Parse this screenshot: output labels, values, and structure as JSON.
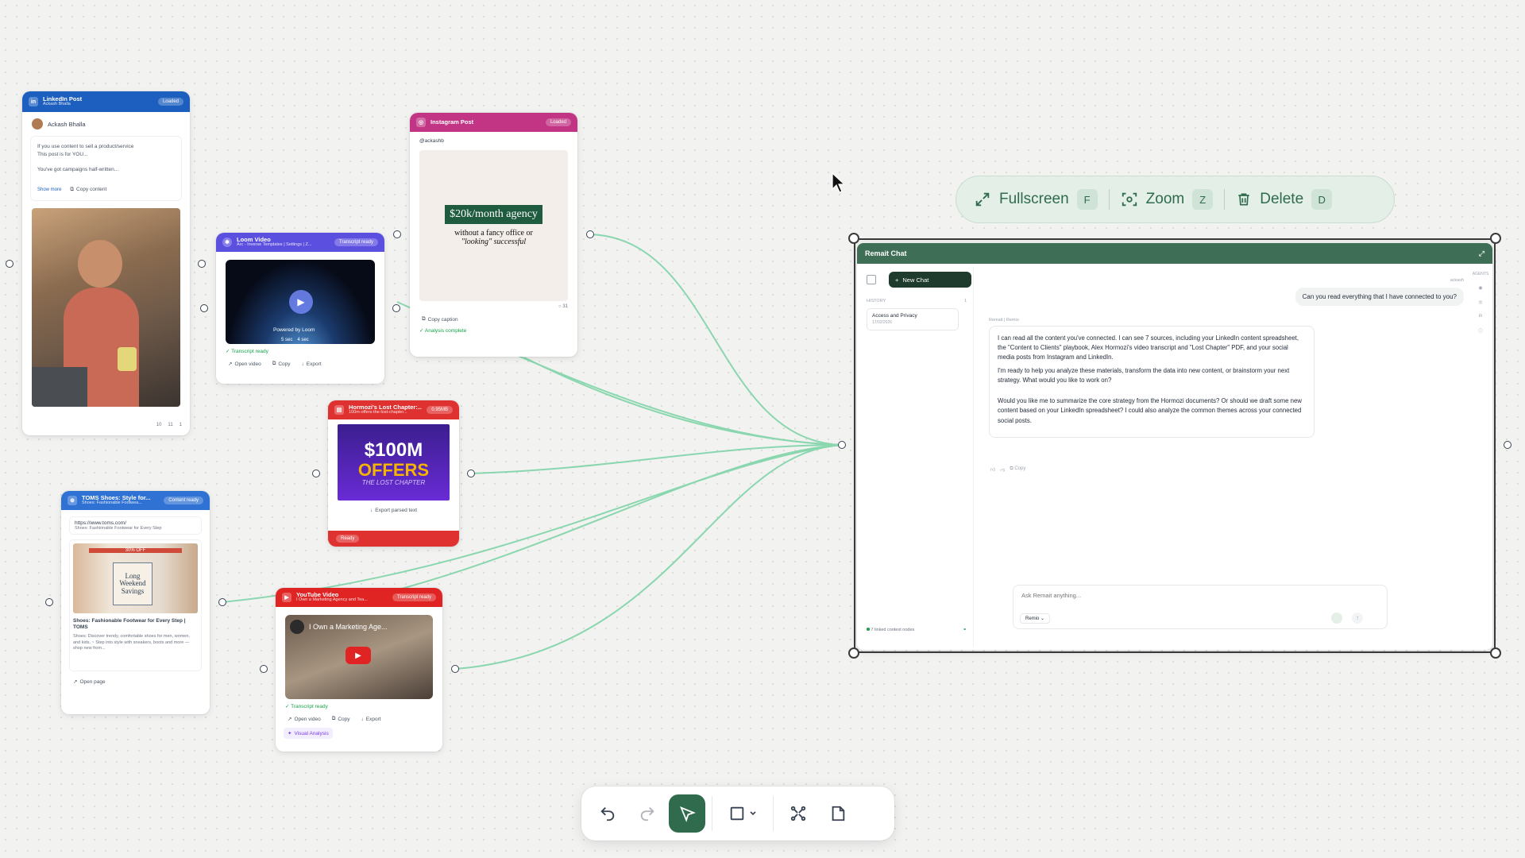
{
  "hover_toolbar": {
    "fullscreen": {
      "label": "Fullscreen",
      "key": "F"
    },
    "zoom": {
      "label": "Zoom",
      "key": "Z"
    },
    "delete": {
      "label": "Delete",
      "key": "D"
    }
  },
  "linkedin": {
    "title": "LinkedIn Post",
    "subtitle": "Ackash Bhalla",
    "status": "Loaded",
    "author": "Ackash Bhalla",
    "lines": [
      "If you use content to sell a product/service",
      "This post is for YOU...",
      "You've got campaigns half-written..."
    ],
    "show_more": "Show more",
    "copy": "Copy content",
    "stats": [
      "10",
      "11",
      "1"
    ]
  },
  "loom": {
    "title": "Loom Video",
    "subtitle": "Arc - Inverse Templates | Settings | Z...",
    "status": "Transcript ready",
    "powered": "Powered by",
    "brand": "Loom",
    "duration": "5 sec",
    "speed": "4 sec",
    "transcript": "Transcript ready",
    "open": "Open video",
    "copy": "Copy",
    "export": "Export"
  },
  "instagram": {
    "title": "Instagram Post",
    "status": "Loaded",
    "handle": "@ackashb",
    "headline": "$20k/month agency",
    "line1": "without a fancy office or",
    "line2": "\"looking\" successful",
    "comments": "31",
    "copy": "Copy caption",
    "analysis": "Analysis complete"
  },
  "pdf": {
    "title": "Hormozi's Lost Chapter:...",
    "subtitle": "100m-offers-the-lost-chapter...",
    "status": "0.95MB",
    "cover1": "$100M",
    "cover2": "OFFERS",
    "cover3": "THE LOST CHAPTER",
    "export": "Export parsed text",
    "ready": "Ready"
  },
  "toms": {
    "title": "TOMS Shoes: Style for...",
    "subtitle": "Shoes: Fashionable Footwea...",
    "status": "Content ready",
    "url": "https://www.toms.com/",
    "url_desc": "Shoes: Fashionable Footwear for Every Step",
    "promo": "30% OFF",
    "banner1": "Long",
    "banner2": "Weekend",
    "banner3": "Savings",
    "page_title": "Shoes: Fashionable Footwear for Every Step | TOMS",
    "page_desc": "Shoes: Discover trendy, comfortable shoes for men, women, and kids. ~ Step into style with sneakers, boots and more — shop new from...",
    "open": "Open page"
  },
  "youtube": {
    "title": "YouTube Video",
    "subtitle": "I Own a Marketing Agency and Tea...",
    "status": "Transcript ready",
    "video_title": "I Own a Marketing Age...",
    "transcript": "Transcript ready",
    "open": "Open video",
    "copy": "Copy",
    "export": "Export",
    "visual": "Visual Analysis"
  },
  "chat": {
    "title": "Remait Chat",
    "new_chat": "New Chat",
    "history_label": "HISTORY",
    "history_count": "1",
    "history_item": "Access and Privacy",
    "history_date": "17/02/2026",
    "agents_label": "AGENTS",
    "user_name": "ackash",
    "user_msg": "Can you read everything that I have connected to you?",
    "ai_name": "Remait | Remio",
    "ai_p1": "I can read all the content you've connected. I can see 7 sources, including your LinkedIn content spreadsheet, the \"Content to Clients\" playbook, Alex Hormozi's video transcript and \"Lost Chapter\" PDF, and your social media posts from Instagram and LinkedIn.",
    "ai_p2": "I'm ready to help you analyze these materials, transform the data into new content, or brainstorm your next strategy. What would you like to work on?",
    "ai_p3": "Would you like me to summarize the core strategy from the Hormozi documents? Or should we draft some new content based on your LinkedIn spreadsheet? I could also analyze the common themes across your connected social posts.",
    "ai_copy": "Copy",
    "linked": "7 linked context nodes",
    "input_placeholder": "Ask Remait anything...",
    "model": "Remio"
  },
  "colors": {
    "accent": "#2f6b4c",
    "edge": "#6fcf9f",
    "linkedin": "#1d5fbf",
    "loom": "#5b4fe0",
    "instagram": "#c13584",
    "pdf": "#e03131",
    "toms": "#2f72d4",
    "youtube": "#e02424"
  },
  "tools": [
    "undo-icon",
    "redo-icon",
    "select-icon",
    "shape-icon",
    "connect-icon",
    "note-icon"
  ]
}
